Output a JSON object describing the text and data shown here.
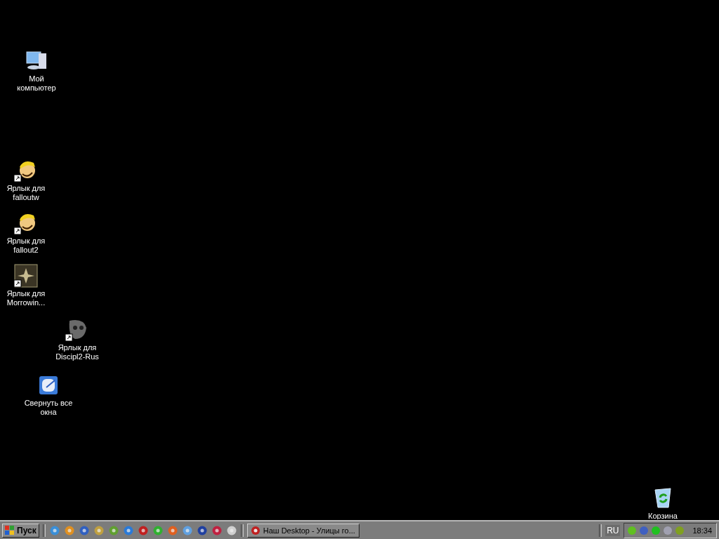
{
  "desktop_icons": [
    {
      "label": "Мой компьютер",
      "kind": "computer",
      "shortcut": false
    },
    {
      "label": "Ярлык для falloutw",
      "kind": "cartoon",
      "shortcut": true
    },
    {
      "label": "Ярлык для fallout2",
      "kind": "cartoon",
      "shortcut": true
    },
    {
      "label": "Ярлык для Morrowin...",
      "kind": "emblem",
      "shortcut": true
    },
    {
      "label": "Ярлык для Discipl2-Rus",
      "kind": "skull",
      "shortcut": true
    },
    {
      "label": "Свернуть все окна",
      "kind": "minimize",
      "shortcut": false
    },
    {
      "label": "Корзина",
      "kind": "bin",
      "shortcut": false
    }
  ],
  "taskbar": {
    "start_button": "Пуск",
    "task_buttons": [
      {
        "label": "Наш Desktop - Улицы го...",
        "selected": false
      }
    ],
    "language": "RU",
    "clock": "18:34"
  }
}
